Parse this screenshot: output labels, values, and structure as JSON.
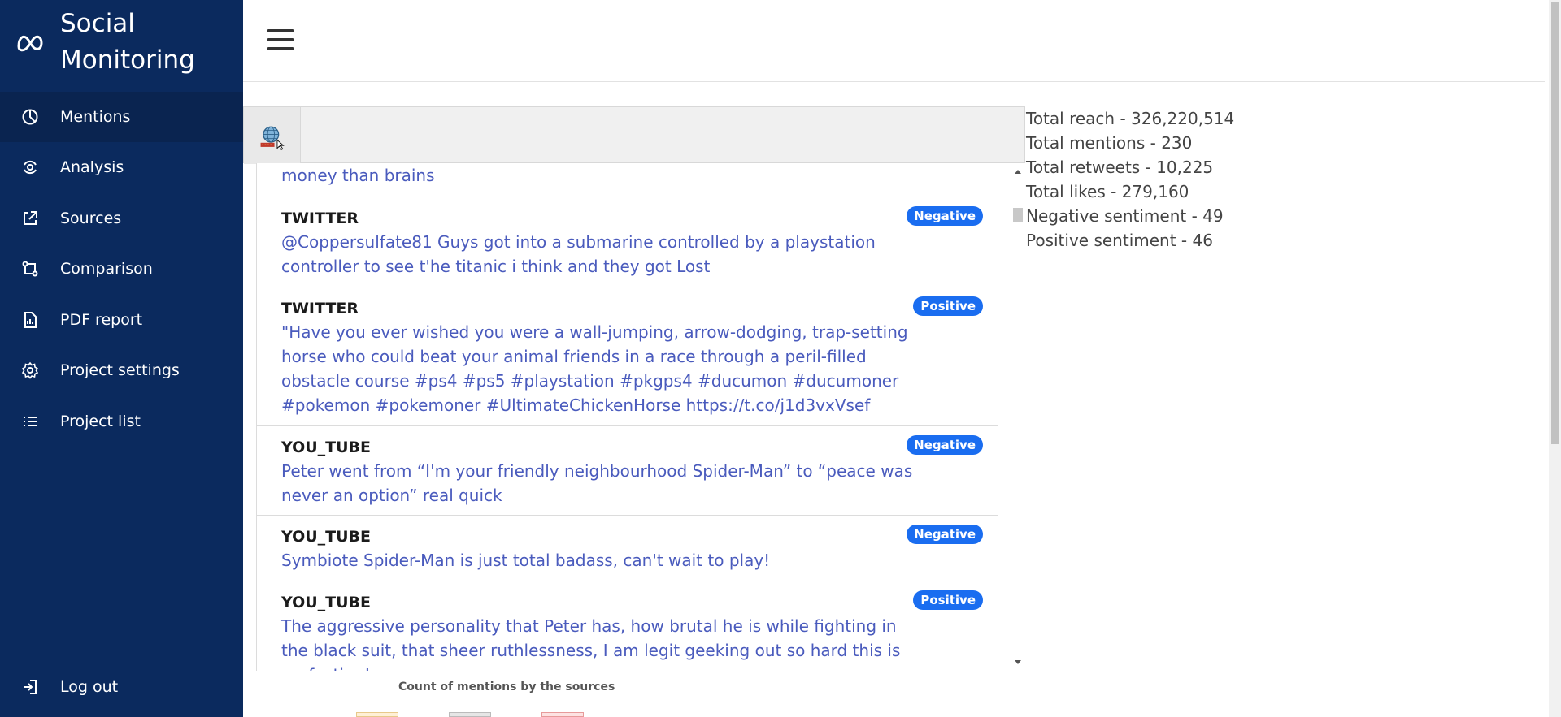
{
  "app": {
    "title": "Social Monitoring"
  },
  "sidebar": {
    "items": [
      {
        "label": "Mentions",
        "icon": "pie-chart-icon",
        "active": true
      },
      {
        "label": "Analysis",
        "icon": "analysis-icon",
        "active": false
      },
      {
        "label": "Sources",
        "icon": "external-link-icon",
        "active": false
      },
      {
        "label": "Comparison",
        "icon": "compare-icon",
        "active": false
      },
      {
        "label": "PDF report",
        "icon": "pdf-file-icon",
        "active": false
      },
      {
        "label": "Project settings",
        "icon": "gear-icon",
        "active": false
      },
      {
        "label": "Project list",
        "icon": "list-icon",
        "active": false
      }
    ],
    "logout": {
      "label": "Log out",
      "icon": "logout-icon"
    }
  },
  "feed": {
    "mentions": [
      {
        "source": "",
        "text": "money than brains",
        "sentiment": ""
      },
      {
        "source": "TWITTER",
        "text": "@Coppersulfate81 Guys got into a submarine controlled by a playstation controller to see t'he titanic i think and they got Lost",
        "sentiment": "Negative"
      },
      {
        "source": "TWITTER",
        "text": "\"Have you ever wished you were a wall-jumping, arrow-dodging, trap-setting horse who could beat your animal friends in a race through a peril-filled obstacle course #ps4 #ps5 #playstation #pkgps4 #ducumon #ducumoner #pokemon #pokemoner #UltimateChickenHorse https://t.co/j1d3vxVsef",
        "sentiment": "Positive"
      },
      {
        "source": "YOU_TUBE",
        "text": "Peter went from “I'm your friendly neighbourhood Spider-Man” to “peace was never an option” real quick",
        "sentiment": "Negative"
      },
      {
        "source": "YOU_TUBE",
        "text": "Symbiote Spider-Man is just total badass, can't wait to play!",
        "sentiment": "Negative"
      },
      {
        "source": "YOU_TUBE",
        "text": "The aggressive personality that Peter has, how brutal he is while fighting in the black suit, that sheer ruthlessness, I am legit geeking out so hard this is perfection!",
        "sentiment": "Positive"
      }
    ]
  },
  "stats": {
    "reach": "Total reach - 326,220,514",
    "mentions": "Total mentions - 230",
    "retweets": "Total retweets - 10,225",
    "likes": "Total likes - 279,160",
    "negative": "Negative sentiment - 49",
    "positive": "Positive sentiment - 46"
  },
  "chart": {
    "title": "Count of mentions by the sources"
  },
  "colors": {
    "sidebar": "#0b2a5e",
    "badge": "#1a6df0",
    "mention_text": "#4a5bbd"
  }
}
